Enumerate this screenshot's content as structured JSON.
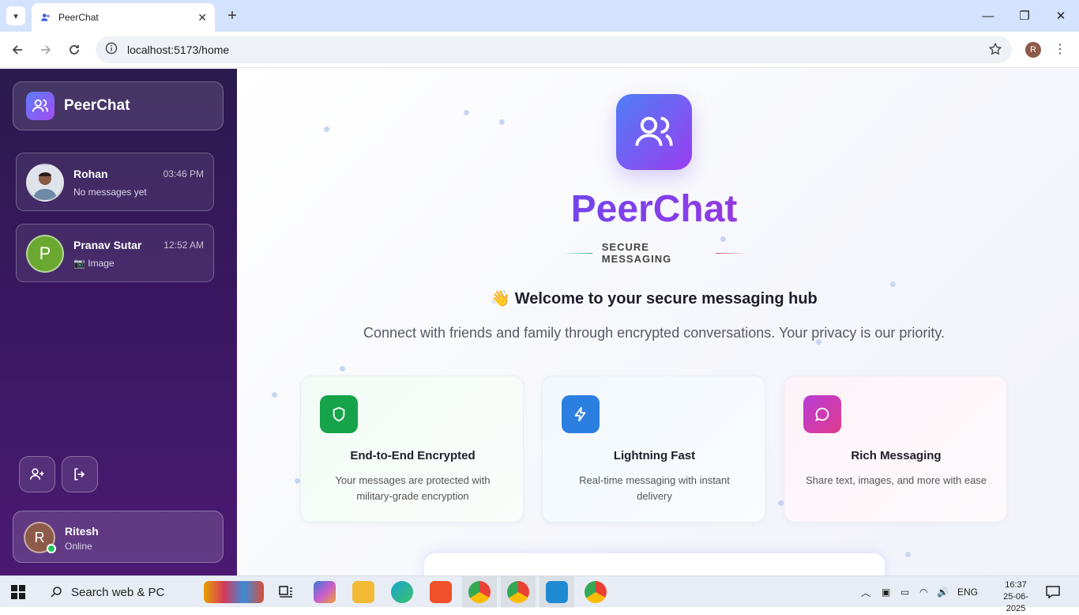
{
  "browser": {
    "tab_title": "PeerChat",
    "url": "localhost:5173/home",
    "profile_initial": "R"
  },
  "sidebar": {
    "brand": "PeerChat",
    "chats": [
      {
        "name": "Rohan",
        "time": "03:46 PM",
        "last_message": "No messages yet",
        "avatar": "photo"
      },
      {
        "name": "Pranav Sutar",
        "time": "12:52 AM",
        "last_message": "📷 Image",
        "avatar_initial": "P",
        "avatar_color": "#6aa832"
      }
    ],
    "current_user": {
      "name": "Ritesh",
      "status": "Online",
      "initial": "R"
    }
  },
  "main": {
    "title": "PeerChat",
    "tagline": "SECURE MESSAGING",
    "welcome": "👋 Welcome to your secure messaging hub",
    "subtitle": "Connect with friends and family through encrypted conversations. Your privacy is our priority.",
    "features": [
      {
        "title": "End-to-End Encrypted",
        "desc": "Your messages are protected with military-grade encryption",
        "icon": "shield-icon",
        "color": "#16a34a"
      },
      {
        "title": "Lightning Fast",
        "desc": "Real-time messaging with instant delivery",
        "icon": "bolt-icon",
        "color": "#2b7fe0"
      },
      {
        "title": "Rich Messaging",
        "desc": "Share text, images, and more with ease",
        "icon": "message-icon",
        "color": "#c73bc9"
      }
    ]
  },
  "taskbar": {
    "search_label": "Search web & PC",
    "language": "ENG",
    "time": "16:37",
    "date": "25-06-2025"
  }
}
